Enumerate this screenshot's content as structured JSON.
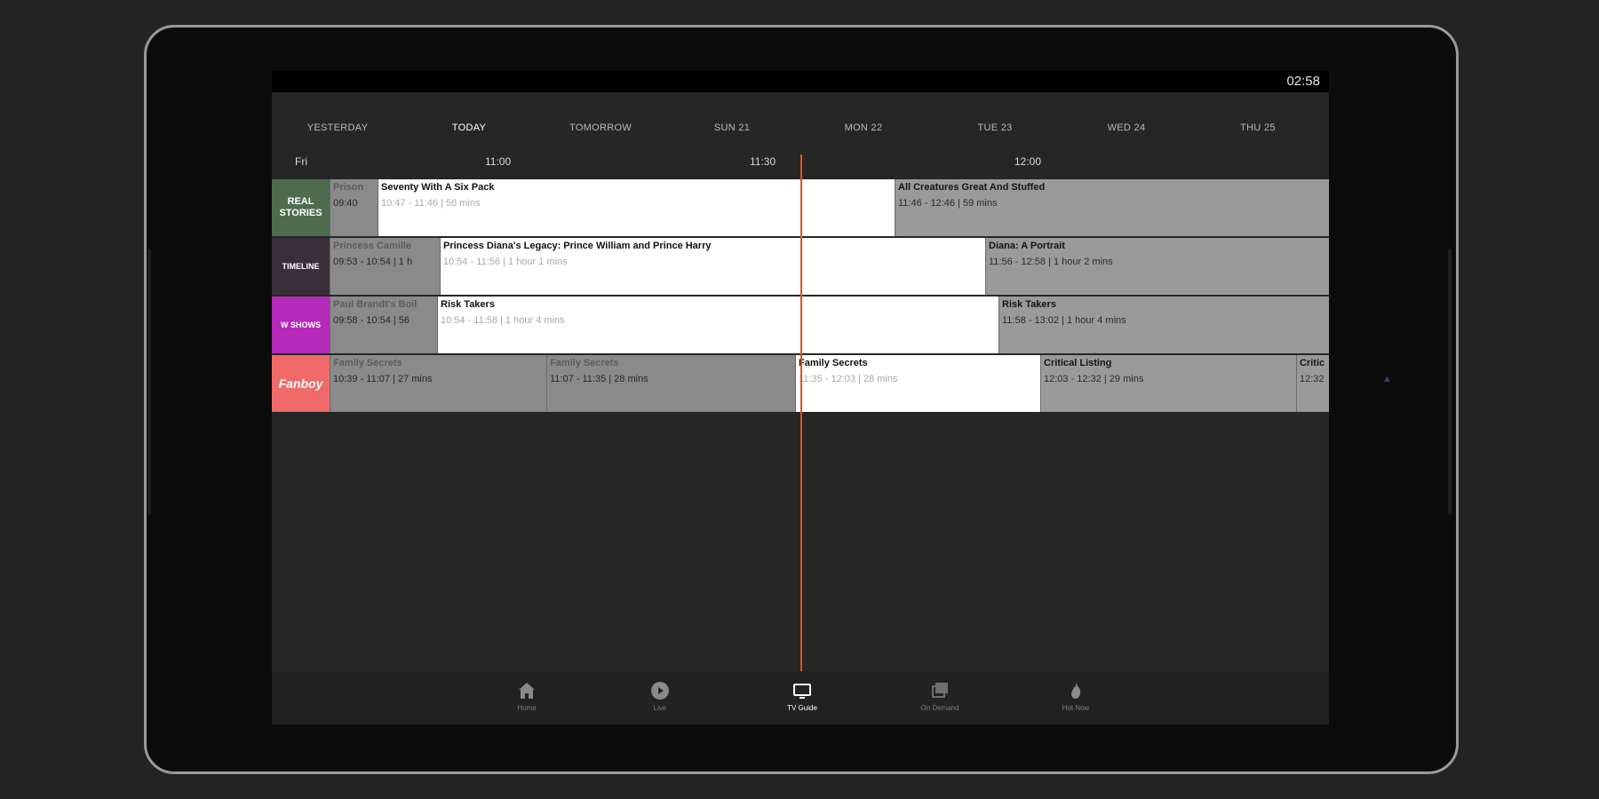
{
  "status": {
    "clock": "02:58"
  },
  "day_tabs": [
    {
      "label": "YESTERDAY",
      "active": false
    },
    {
      "label": "TODAY",
      "active": true
    },
    {
      "label": "TOMORROW",
      "active": false
    },
    {
      "label": "SUN 21",
      "active": false
    },
    {
      "label": "MON 22",
      "active": false
    },
    {
      "label": "TUE 23",
      "active": false
    },
    {
      "label": "WED 24",
      "active": false
    },
    {
      "label": "THU 25",
      "active": false
    }
  ],
  "timescale": {
    "day": "Fri",
    "t1": "11:00",
    "t2": "11:30",
    "t3": "12:00"
  },
  "channels": [
    {
      "logo_text": "REAL STORIES",
      "logo_color": "#4e6b4e",
      "programs": [
        {
          "title": "Prison",
          "time": "09:40",
          "state": "past"
        },
        {
          "title": "Seventy With A Six Pack",
          "time": "10:47 - 11:46 | 58 mins",
          "state": "now"
        },
        {
          "title": "All Creatures Great And Stuffed",
          "time": "11:46 - 12:46 | 59 mins",
          "state": "future"
        }
      ]
    },
    {
      "logo_text": "TIMELINE",
      "logo_color": "#3a2e3a",
      "programs": [
        {
          "title": "Princess Camille",
          "time": "09:53 - 10:54 | 1 h",
          "state": "past"
        },
        {
          "title": "Princess Diana's Legacy: Prince William and Prince Harry",
          "time": "10:54 - 11:56 | 1 hour 1 mins",
          "state": "now"
        },
        {
          "title": "Diana: A Portrait",
          "time": "11:56 - 12:58 | 1 hour 2 mins",
          "state": "future"
        }
      ]
    },
    {
      "logo_text": "W SHOWS",
      "logo_color": "#b52ab8",
      "programs": [
        {
          "title": "Paul Brandt's Boil",
          "time": "09:58 - 10:54 | 56",
          "state": "past"
        },
        {
          "title": "Risk Takers",
          "time": "10:54 - 11:58 | 1 hour 4 mins",
          "state": "now"
        },
        {
          "title": "Risk Takers",
          "time": "11:58 - 13:02 | 1 hour 4 mins",
          "state": "future"
        }
      ]
    },
    {
      "logo_text": "Fanboy",
      "logo_color": "#f06a6a",
      "programs": [
        {
          "title": "Family Secrets",
          "time": "10:39 - 11:07 | 27 mins",
          "state": "past"
        },
        {
          "title": "Family Secrets",
          "time": "11:07 - 11:35 | 28 mins",
          "state": "past"
        },
        {
          "title": "Family Secrets",
          "time": "11:35 - 12:03 | 28 mins",
          "state": "now"
        },
        {
          "title": "Critical Listing",
          "time": "12:03 - 12:32 | 29 mins",
          "state": "future"
        },
        {
          "title": "Critic",
          "time": "12:32",
          "state": "future"
        }
      ]
    }
  ],
  "bottom_nav": [
    {
      "label": "Home",
      "icon": "home-icon",
      "active": false
    },
    {
      "label": "Live",
      "icon": "play-circle-icon",
      "active": false
    },
    {
      "label": "TV Guide",
      "icon": "tv-icon",
      "active": true
    },
    {
      "label": "On Demand",
      "icon": "library-icon",
      "active": false
    },
    {
      "label": "Hot Now",
      "icon": "flame-icon",
      "active": false
    }
  ],
  "colors": {
    "now_line": "#e0531f",
    "accent_white": "#ffffff"
  }
}
